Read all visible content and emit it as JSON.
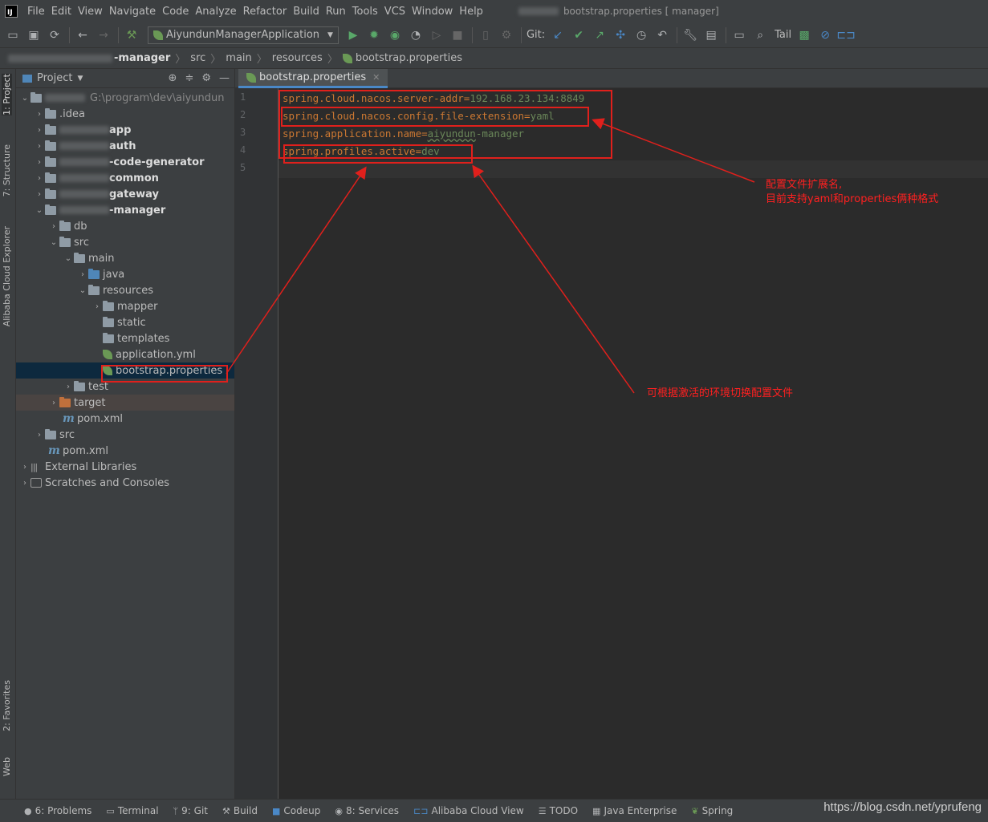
{
  "menubar": {
    "items": [
      "File",
      "Edit",
      "View",
      "Navigate",
      "Code",
      "Analyze",
      "Refactor",
      "Build",
      "Run",
      "Tools",
      "VCS",
      "Window",
      "Help"
    ],
    "window_title": "bootstrap.properties [ manager]"
  },
  "toolbar": {
    "run_config": "AiyundunManagerApplication",
    "git_label": "Git:",
    "tail_label": "Tail"
  },
  "breadcrumb": [
    "-manager",
    "src",
    "main",
    "resources",
    "bootstrap.properties"
  ],
  "left_stripe": {
    "project_tab": "1: Project",
    "structure_tab": "7: Structure",
    "cloud_tab": "Alibaba Cloud Explorer",
    "favorites_tab": "2: Favorites",
    "web_tab": "Web"
  },
  "project_panel": {
    "title": "Project",
    "root_path": "G:\\program\\dev\\aiyundun",
    "items": {
      "idea": ".idea",
      "app": "app",
      "auth": "auth",
      "codegen": "-code-generator",
      "common": "common",
      "gateway": "gateway",
      "manager": "-manager",
      "db": "db",
      "src": "src",
      "main": "main",
      "java": "java",
      "resources": "resources",
      "mapper": "mapper",
      "static": "static",
      "templates": "templates",
      "application_yml": "application.yml",
      "bootstrap": "bootstrap.properties",
      "test": "test",
      "target": "target",
      "pom_inner": "pom.xml",
      "src_root": "src",
      "pom_root": "pom.xml",
      "external_libraries": "External Libraries",
      "scratches": "Scratches and Consoles"
    }
  },
  "editor": {
    "tab_label": "bootstrap.properties",
    "line_numbers": [
      "1",
      "2",
      "3",
      "4",
      "5"
    ],
    "lines": [
      {
        "key": "spring.cloud.nacos.server-addr",
        "value": "192.168.23.134:8849"
      },
      {
        "key": "spring.cloud.nacos.config.file-extension",
        "value": "yaml"
      },
      {
        "key": "spring.application.name",
        "value": "aiyundun",
        "value_rest": "-manager"
      },
      {
        "key": "spring.profiles.active",
        "value": "dev"
      }
    ]
  },
  "annotations": {
    "file_extension_line1": "配置文件扩展名,",
    "file_extension_line2": "目前支持yaml和properties俩种格式",
    "profile_note": "可根据激活的环境切换配置文件"
  },
  "statusbar": {
    "items": [
      "6: Problems",
      "Terminal",
      "9: Git",
      "Build",
      "Codeup",
      "8: Services",
      "Alibaba Cloud View",
      "TODO",
      "Java Enterprise",
      "Spring"
    ]
  },
  "watermark": "https://blog.csdn.net/yprufeng",
  "colors": {
    "keyword": "#cc7832",
    "string": "#6a8759",
    "annotation": "#e0201c",
    "selection": "#0d293e"
  }
}
